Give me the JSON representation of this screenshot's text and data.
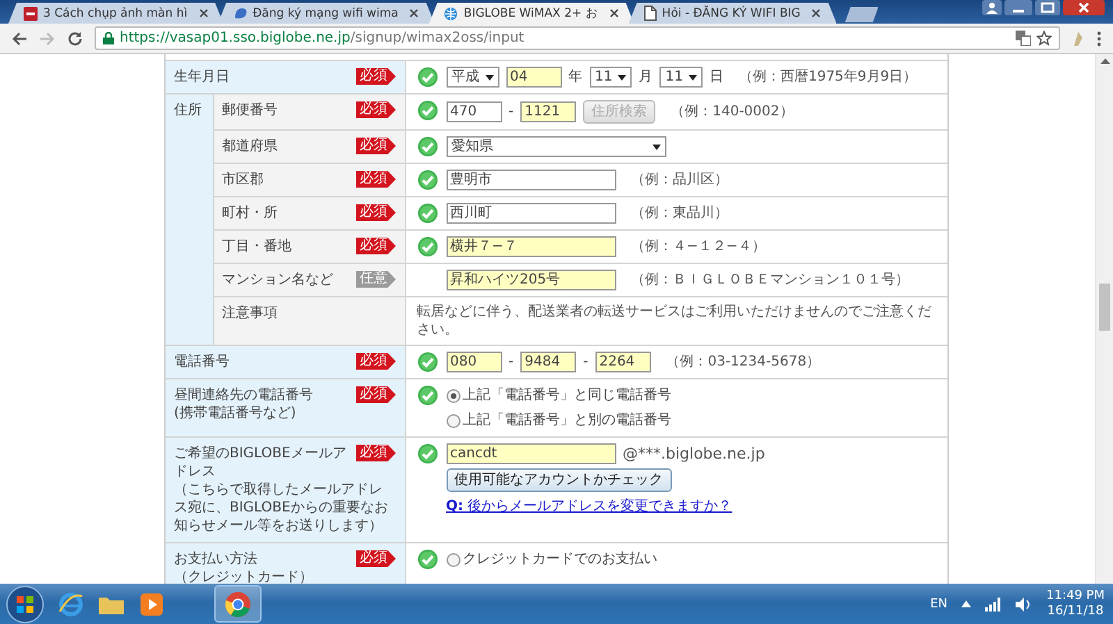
{
  "browser": {
    "tabs": [
      {
        "title": "3 Cách chụp ảnh màn hì",
        "selected": false
      },
      {
        "title": "Đăng ký mạng wifi wima",
        "selected": false
      },
      {
        "title": "BIGLOBE WiMAX 2+ お",
        "selected": true
      },
      {
        "title": "Hỏi - ĐĂNG KÝ WIFI BIG",
        "selected": false
      }
    ],
    "url": {
      "origin": "https://vasap01.sso.biglobe.ne.jp",
      "path": "/signup/wimax2oss/input"
    }
  },
  "form": {
    "rows": [
      {
        "kind": "field",
        "label": "生年月日",
        "badge": {
          "kind": "required",
          "text": "必須"
        },
        "valid": true,
        "lines": [
          [
            {
              "kind": "select",
              "value": "平成"
            },
            {
              "kind": "number",
              "value": "04",
              "highlighted": true
            },
            {
              "kind": "unit",
              "text": "年"
            },
            {
              "kind": "select",
              "value": "11"
            },
            {
              "kind": "unit",
              "text": "月"
            },
            {
              "kind": "select",
              "value": "11"
            },
            {
              "kind": "unit",
              "text": "日"
            },
            {
              "kind": "hint",
              "text": "（例：西暦1975年9月9日）"
            }
          ]
        ]
      },
      {
        "kind": "group",
        "label": "住所",
        "children": [
          {
            "label": "郵便番号",
            "badge": {
              "kind": "required",
              "text": "必須"
            },
            "valid": true,
            "lines": [
              [
                {
                  "kind": "number",
                  "value": "470",
                  "highlighted": false
                },
                {
                  "kind": "separator",
                  "text": "-"
                },
                {
                  "kind": "number",
                  "value": "1121",
                  "highlighted": true
                },
                {
                  "kind": "button",
                  "label": "住所検索",
                  "disabled": true
                },
                {
                  "kind": "hint",
                  "text": "（例：140-0002）"
                }
              ]
            ]
          },
          {
            "label": "都道府県",
            "badge": {
              "kind": "required",
              "text": "必須"
            },
            "valid": true,
            "lines": [
              [
                {
                  "kind": "wide-select",
                  "value": "愛知県"
                }
              ]
            ]
          },
          {
            "label": "市区郡",
            "badge": {
              "kind": "required",
              "text": "必須"
            },
            "valid": true,
            "lines": [
              [
                {
                  "kind": "text",
                  "value": "豊明市",
                  "highlighted": false
                },
                {
                  "kind": "hint",
                  "text": "（例：品川区）"
                }
              ]
            ]
          },
          {
            "label": "町村・所",
            "badge": {
              "kind": "required",
              "text": "必須"
            },
            "valid": true,
            "lines": [
              [
                {
                  "kind": "text",
                  "value": "西川町",
                  "highlighted": false
                },
                {
                  "kind": "hint",
                  "text": "（例：東品川）"
                }
              ]
            ]
          },
          {
            "label": "丁目・番地",
            "badge": {
              "kind": "required",
              "text": "必須"
            },
            "valid": true,
            "lines": [
              [
                {
                  "kind": "text",
                  "value": "横井７−７",
                  "highlighted": true
                },
                {
                  "kind": "hint",
                  "text": "（例：４−１２−４）"
                }
              ]
            ]
          },
          {
            "label": "マンション名など",
            "badge": {
              "kind": "optional",
              "text": "任意"
            },
            "valid": false,
            "lines": [
              [
                {
                  "kind": "text",
                  "value": "昇和ハイツ205号",
                  "highlighted": true
                },
                {
                  "kind": "hint",
                  "text": "（例：ＢＩＧＬＯＢＥマンション１０１号）"
                }
              ]
            ]
          },
          {
            "label": "注意事項",
            "valid": false,
            "lines": [
              [
                {
                  "kind": "note",
                  "text": "転居などに伴う、配送業者の転送サービスはご利用いただけませんのでご注意ください。"
                }
              ]
            ]
          }
        ]
      },
      {
        "kind": "field",
        "label": "電話番号",
        "badge": {
          "kind": "required",
          "text": "必須"
        },
        "valid": true,
        "lines": [
          [
            {
              "kind": "number",
              "value": "080",
              "highlighted": true
            },
            {
              "kind": "separator",
              "text": "-"
            },
            {
              "kind": "number",
              "value": "9484",
              "highlighted": true
            },
            {
              "kind": "separator",
              "text": "-"
            },
            {
              "kind": "number",
              "value": "2264",
              "highlighted": true
            },
            {
              "kind": "hint",
              "text": "（例：03-1234-5678）"
            }
          ]
        ]
      },
      {
        "kind": "field",
        "label": "昼間連絡先の電話番号",
        "sublabel": "(携帯電話番号など)",
        "badge": {
          "kind": "required",
          "text": "必須"
        },
        "valid": true,
        "lines": [
          [
            {
              "kind": "radio",
              "label": "上記「電話番号」と同じ電話番号",
              "selected": true
            }
          ],
          [
            {
              "kind": "radio",
              "label": "上記「電話番号」と別の電話番号",
              "selected": false
            }
          ]
        ]
      },
      {
        "kind": "field",
        "label": "ご希望のBIGLOBEメールアドレス",
        "sublabel": "（こちらで取得したメールアドレス宛に、BIGLOBEからの重要なお知らせメール等をお送りします）",
        "badge": {
          "kind": "required",
          "text": "必須"
        },
        "valid": true,
        "lines": [
          [
            {
              "kind": "text",
              "value": "cancdt",
              "highlighted": true
            },
            {
              "kind": "suffix",
              "text": "@***.biglobe.ne.jp"
            }
          ],
          [
            {
              "kind": "button",
              "label": "使用可能なアカウントかチェック",
              "disabled": false
            }
          ],
          [
            {
              "kind": "link",
              "text": "**Q:** 後からメールアドレスを変更できますか？"
            }
          ]
        ]
      },
      {
        "kind": "field",
        "label": "お支払い方法",
        "sublabel": "（クレジットカード）",
        "badge": {
          "kind": "required",
          "text": "必須"
        },
        "valid": true,
        "lines": [
          [
            {
              "kind": "radio",
              "label": "クレジットカードでのお支払い",
              "selected": false
            }
          ]
        ]
      }
    ]
  },
  "taskbar": {
    "language": "EN",
    "time": "11:49 PM",
    "date": "16/11/18"
  }
}
